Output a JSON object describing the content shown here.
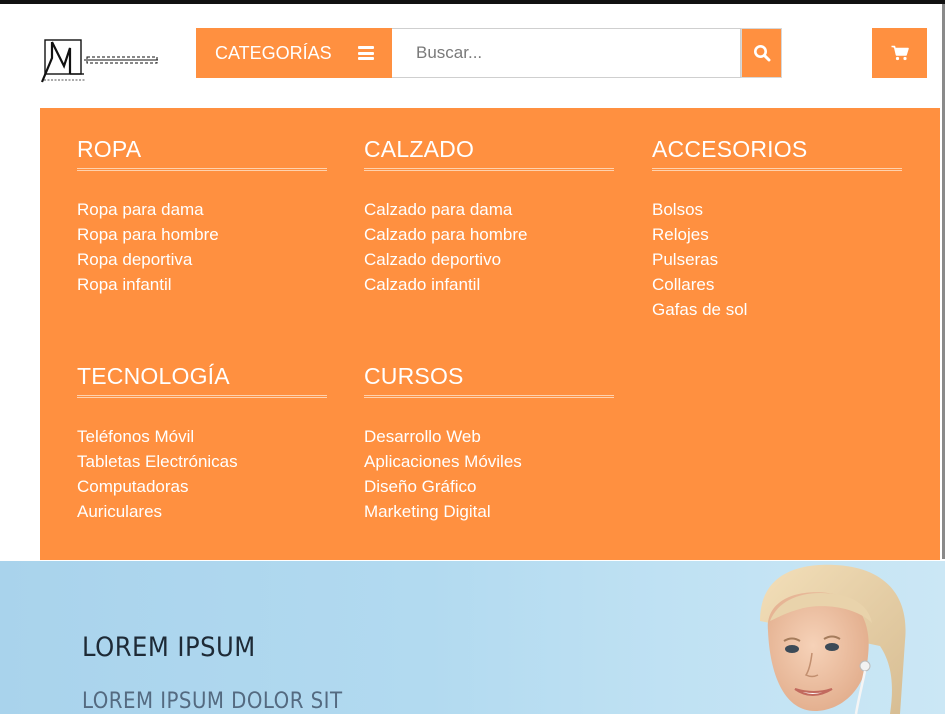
{
  "header": {
    "logo_name": "logo",
    "categories_label": "CATEGORÍAS",
    "menu_icon": "menu-icon",
    "search_placeholder": "Buscar...",
    "search_icon": "search-icon",
    "cart_icon": "cart-icon"
  },
  "colors": {
    "accent": "#FF9040",
    "hero_bg": "#B2DAF0",
    "text_on_accent": "#FFFFFF"
  },
  "mega_menu": {
    "columns": [
      {
        "title": "ROPA",
        "items": [
          "Ropa para dama",
          "Ropa para hombre",
          "Ropa deportiva",
          "Ropa infantil"
        ]
      },
      {
        "title": "CALZADO",
        "items": [
          "Calzado para dama",
          "Calzado para hombre",
          "Calzado deportivo",
          "Calzado infantil"
        ]
      },
      {
        "title": "ACCESORIOS",
        "items": [
          "Bolsos",
          "Relojes",
          "Pulseras",
          "Collares",
          "Gafas de sol"
        ]
      },
      {
        "title": "TECNOLOGÍA",
        "items": [
          "Teléfonos Móvil",
          "Tabletas Electrónicas",
          "Computadoras",
          "Auriculares"
        ]
      },
      {
        "title": "CURSOS",
        "items": [
          "Desarrollo Web",
          "Aplicaciones Móviles",
          "Diseño Gráfico",
          "Marketing Digital"
        ]
      }
    ]
  },
  "hero": {
    "title": "LOREM IPSUM",
    "subtitle": "LOREM IPSUM DOLOR SIT"
  }
}
